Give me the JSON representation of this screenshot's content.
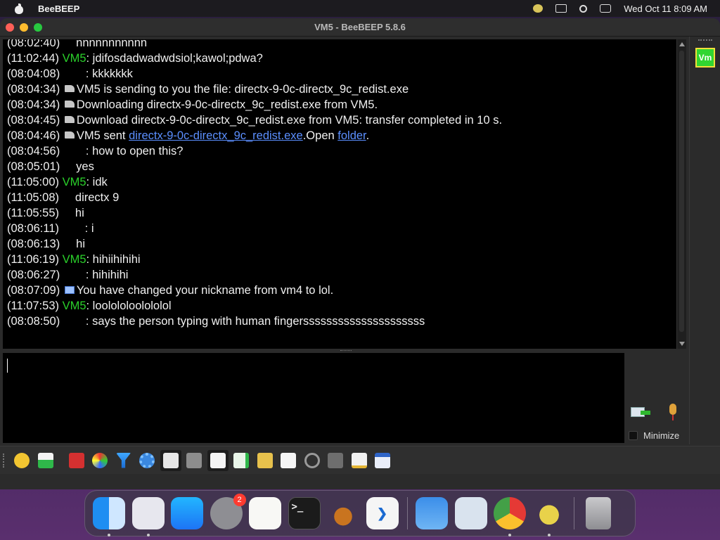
{
  "menubar": {
    "app_name": "BeeBEEP",
    "clock": "Wed Oct 11  8:09 AM",
    "status_icons": [
      "beebeep-tray-icon",
      "window-switcher-icon",
      "search-icon",
      "control-center-icon"
    ]
  },
  "window": {
    "title": "VM5 - BeeBEEP 5.8.6"
  },
  "chat": {
    "lines": [
      {
        "time": "(08:02:40)",
        "sender": "",
        "sep": "    ",
        "text": "nnnnnnnnnnn"
      },
      {
        "time": "(11:02:44)",
        "sender": "VM5",
        "sep": ": ",
        "text": "jdifosdadwadwdsiol;kawol;pdwa?"
      },
      {
        "time": "(08:04:08)",
        "sender": "",
        "sep": "       ",
        "text": ": kkkkkkk"
      },
      {
        "time": "(08:04:34)",
        "icon": "file",
        "text": "VM5 is sending to you the file: directx-9-0c-directx_9c_redist.exe"
      },
      {
        "time": "(08:04:34)",
        "icon": "file",
        "text": "Downloading directx-9-0c-directx_9c_redist.exe from VM5."
      },
      {
        "time": "(08:04:45)",
        "icon": "file",
        "text": "Download directx-9-0c-directx_9c_redist.exe from VM5: transfer completed in 10 s."
      },
      {
        "time": "(08:04:46)",
        "icon": "file",
        "prefix": "VM5 sent ",
        "link1": "directx-9-0c-directx_9c_redist.exe",
        "mid": ".Open ",
        "link2": "folder",
        "suffix": "."
      },
      {
        "time": "(08:04:56)",
        "sender": "",
        "sep": "       ",
        "text": ": how to open this?"
      },
      {
        "time": "(08:05:01)",
        "sender": "",
        "sep": "    ",
        "text": "yes"
      },
      {
        "time": "(11:05:00)",
        "sender": "VM5",
        "sep": ": ",
        "text": "idk"
      },
      {
        "time": "(11:05:08)",
        "sender": "",
        "sep": "    ",
        "text": "directx 9"
      },
      {
        "time": "(11:05:55)",
        "sender": "",
        "sep": "    ",
        "text": "hi"
      },
      {
        "time": "(08:06:11)",
        "sender": "",
        "sep": "       ",
        "text": ": i"
      },
      {
        "time": "(08:06:13)",
        "sender": "",
        "sep": "    ",
        "text": "hi"
      },
      {
        "time": "(11:06:19)",
        "sender": "VM5",
        "sep": ": ",
        "text": "hihiihihihi"
      },
      {
        "time": "(08:06:27)",
        "sender": "",
        "sep": "       ",
        "text": ": hihihihi"
      },
      {
        "time": "(08:07:09)",
        "icon": "nick",
        "text": "You have changed your nickname from vm4 to lol."
      },
      {
        "time": "(11:07:53)",
        "sender": "VM5",
        "sep": ": ",
        "text": "loolololoolololol"
      },
      {
        "time": "(08:08:50)",
        "sender": "",
        "sep": "       ",
        "text": ": says the person typing with human fingersssssssssssssssssssss"
      }
    ]
  },
  "input": {
    "value": "",
    "minimize_label": "Minimize",
    "send_icon": "send-message-icon",
    "mic_icon": "voice-message-icon"
  },
  "right_panel": {
    "user_badge": "Vm",
    "badge_color": "#31d631"
  },
  "toolbar": {
    "buttons": [
      "emoticons-icon",
      "mail-icon",
      "font-icon",
      "color-palette-icon",
      "filter-icon",
      "settings-icon",
      "spellcheck-icon",
      "dictionary-icon",
      "note-icon",
      "export-icon",
      "send-folder-icon",
      "code-icon",
      "screenshot-icon",
      "screen-share-icon",
      "edit-icon",
      "detach-window-icon"
    ]
  },
  "dock": {
    "apps": [
      {
        "name": "finder",
        "running": true
      },
      {
        "name": "launchpad",
        "running": true
      },
      {
        "name": "app-store",
        "running": false
      },
      {
        "name": "system-settings",
        "running": false,
        "badge": "2"
      },
      {
        "name": "textedit",
        "running": false
      },
      {
        "name": "terminal",
        "running": false
      },
      {
        "name": "garageband",
        "running": false
      },
      {
        "name": "vscode",
        "running": false
      },
      {
        "name": "weather",
        "running": false
      },
      {
        "name": "preview",
        "running": false
      },
      {
        "name": "chrome",
        "running": true
      },
      {
        "name": "beebeep",
        "running": true
      },
      {
        "name": "trash",
        "running": false
      }
    ]
  }
}
